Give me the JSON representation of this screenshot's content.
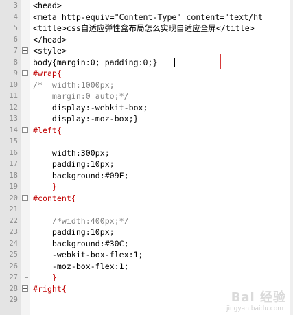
{
  "editor": {
    "lines": [
      {
        "num": "3",
        "text": "<head>",
        "color": "#000000"
      },
      {
        "num": "4",
        "text": "<meta http-equiv=\"Content-Type\" content=\"text/ht",
        "color": "#000000"
      },
      {
        "num": "5",
        "text": "<title>css自适应弹性盒布局怎么实现自适应全屏</title>",
        "color": "#000000"
      },
      {
        "num": "6",
        "text": "</head>",
        "color": "#000000"
      },
      {
        "num": "7",
        "text": "<style>",
        "color": "#000000"
      },
      {
        "num": "8",
        "text": "body{margin:0; padding:0;}",
        "color": "#000000"
      },
      {
        "num": "9",
        "text": "#wrap{",
        "color": "#c00000"
      },
      {
        "num": "10",
        "text": "/*  width:1000px;",
        "color": "#808080"
      },
      {
        "num": "11",
        "text": "    margin:0 auto;*/",
        "color": "#808080"
      },
      {
        "num": "12",
        "text": "    display:-webkit-box;",
        "color": "#000000"
      },
      {
        "num": "13",
        "text": "    display:-moz-box;}",
        "color": "#000000"
      },
      {
        "num": "14",
        "text": "#left{",
        "color": "#c00000"
      },
      {
        "num": "15",
        "text": "",
        "color": "#000000"
      },
      {
        "num": "16",
        "text": "    width:300px;",
        "color": "#000000"
      },
      {
        "num": "17",
        "text": "    padding:10px;",
        "color": "#000000"
      },
      {
        "num": "18",
        "text": "    background:#09F;",
        "color": "#000000"
      },
      {
        "num": "19",
        "text": "    }",
        "color": "#c00000"
      },
      {
        "num": "20",
        "text": "#content{",
        "color": "#c00000"
      },
      {
        "num": "21",
        "text": "",
        "color": "#000000"
      },
      {
        "num": "22",
        "text": "    /*width:400px;*/",
        "color": "#808080"
      },
      {
        "num": "23",
        "text": "    padding:10px;",
        "color": "#000000"
      },
      {
        "num": "24",
        "text": "    background:#30C;",
        "color": "#000000"
      },
      {
        "num": "25",
        "text": "    -webkit-box-flex:1;",
        "color": "#000000"
      },
      {
        "num": "26",
        "text": "    -moz-box-flex:1;",
        "color": "#000000"
      },
      {
        "num": "27",
        "text": "    }",
        "color": "#c00000"
      },
      {
        "num": "28",
        "text": "#right{",
        "color": "#c00000"
      },
      {
        "num": "29",
        "text": "",
        "color": "#000000"
      }
    ]
  },
  "watermark": {
    "main": "Bai 经验",
    "sub": "jingyan.baidu.com"
  },
  "colors": {
    "selector": "#c00000",
    "comment": "#808080",
    "highlight_border": "#d63b3b"
  }
}
